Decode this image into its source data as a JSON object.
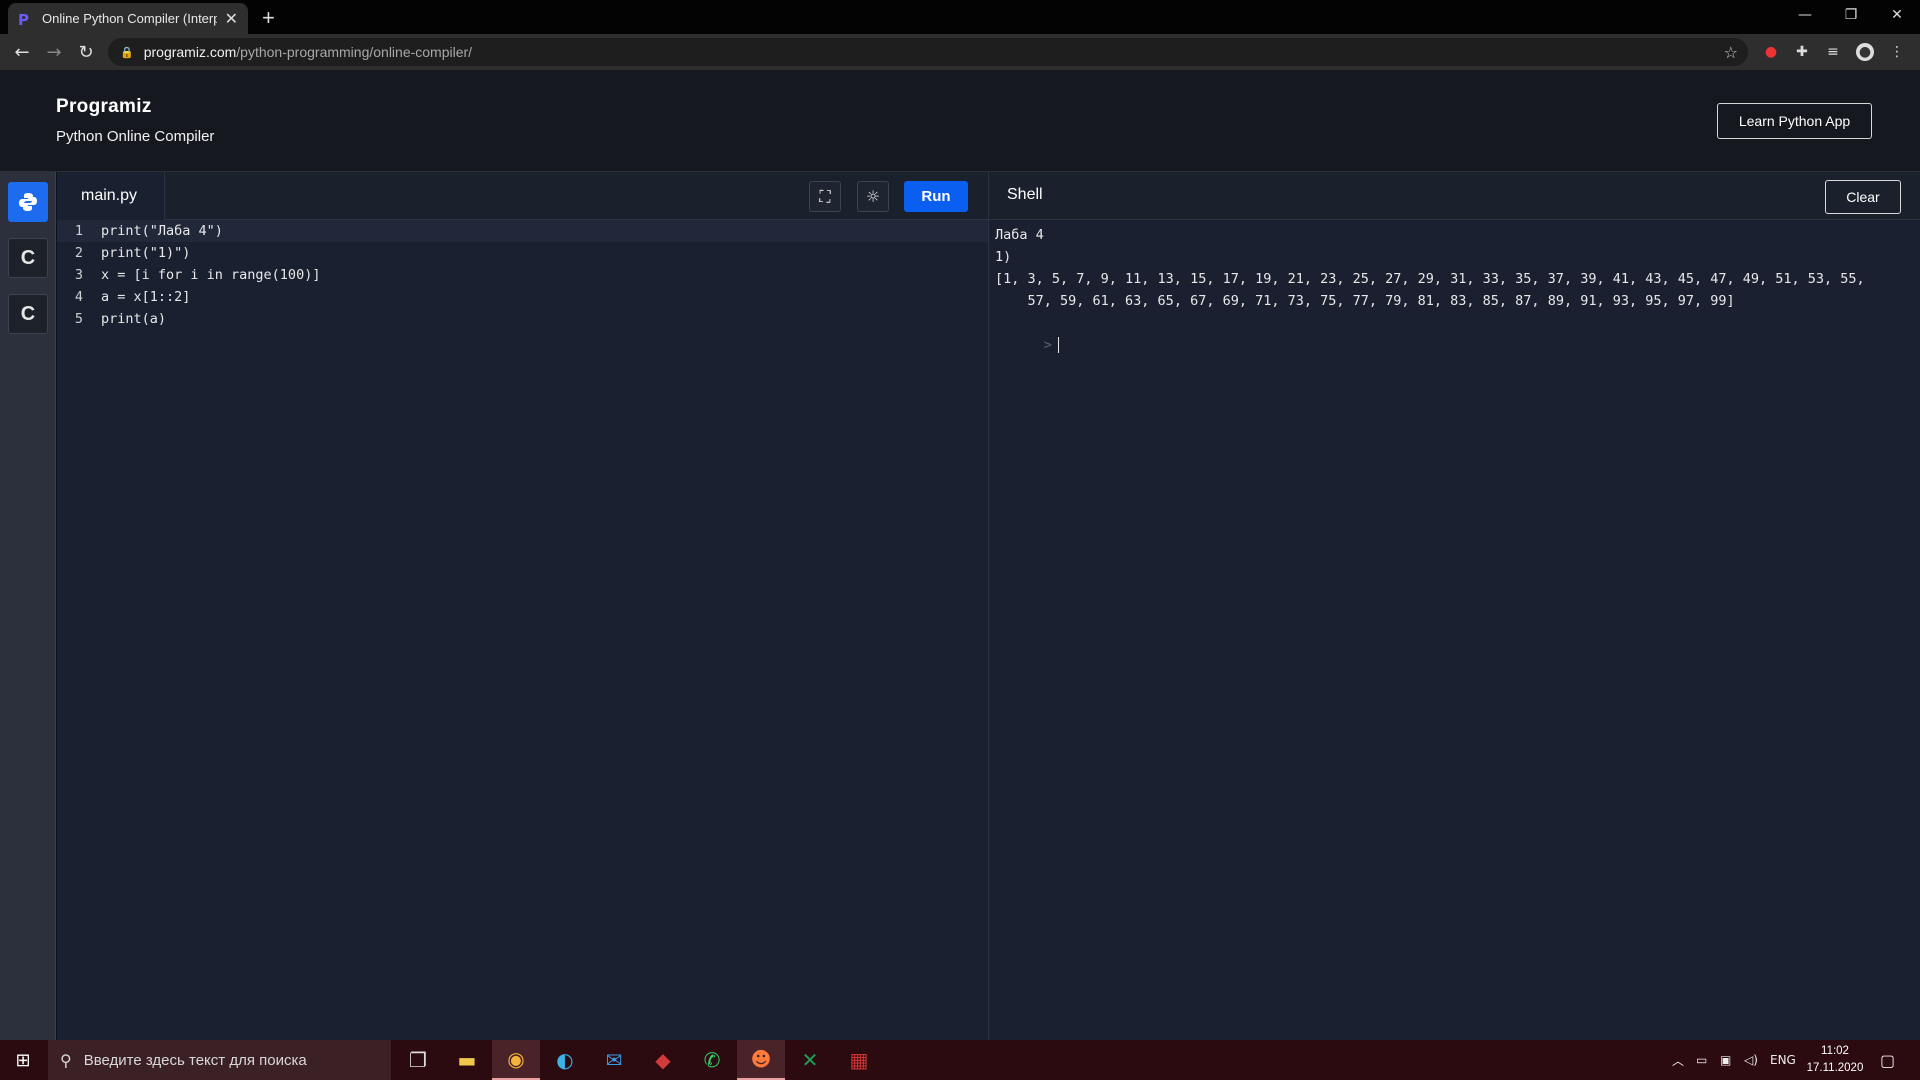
{
  "browser": {
    "tab_title": "Online Python Compiler (Interpre",
    "tab_close": "✕",
    "new_tab": "+",
    "url_domain": "programiz.com",
    "url_path": "/python-programming/online-compiler/",
    "win_minimize": "—",
    "win_restore": "❐",
    "win_close": "✕"
  },
  "site": {
    "logo": "Programiz",
    "subtitle": "Python Online Compiler",
    "learn_button": "Learn Python App"
  },
  "sidebar": {
    "languages": [
      {
        "name": "python",
        "glyph": "🐍",
        "active": true
      },
      {
        "name": "c",
        "glyph": "C",
        "active": false
      },
      {
        "name": "cpp",
        "glyph": "C",
        "active": false
      }
    ]
  },
  "editor": {
    "file_name": "main.py",
    "run_label": "Run",
    "lines": [
      {
        "no": "1",
        "text": "print(\"Лаба 4\")"
      },
      {
        "no": "2",
        "text": "print(\"1)\")"
      },
      {
        "no": "3",
        "text": "x = [i for i in range(100)]"
      },
      {
        "no": "4",
        "text": "a = x[1::2]"
      },
      {
        "no": "5",
        "text": "print(a)"
      }
    ]
  },
  "shell": {
    "title": "Shell",
    "clear_label": "Clear",
    "output": [
      "Лаба 4",
      "1)",
      "[1, 3, 5, 7, 9, 11, 13, 15, 17, 19, 21, 23, 25, 27, 29, 31, 33, 35, 37, 39, 41, 43, 45, 47, 49, 51, 53, 55,",
      "    57, 59, 61, 63, 65, 67, 69, 71, 73, 75, 77, 79, 81, 83, 85, 87, 89, 91, 93, 95, 97, 99]"
    ],
    "prompt": ">"
  },
  "taskbar": {
    "search_placeholder": "Введите здесь текст для поиска",
    "language": "ENG",
    "time": "11:02",
    "date": "17.11.2020"
  },
  "colors": {
    "run_button": "#0a5ef0",
    "active_language": "#1d6cf0",
    "taskbar": "#2b0b0f"
  }
}
